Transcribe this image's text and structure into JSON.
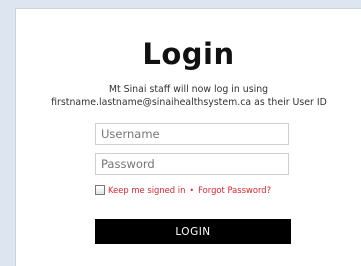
{
  "login": {
    "title": "Login",
    "instructions_line1": "Mt Sinai staff will now log in using",
    "instructions_line2": "firstname.lastname@sinaihealthsystem.ca as their User ID",
    "username_placeholder": "Username",
    "password_placeholder": "Password",
    "remember_label": "Keep me signed in",
    "separator": "•",
    "forgot_label": "Forgot Password?",
    "button_label": "LOGIN"
  },
  "colors": {
    "page_background": "#dde5f1",
    "link_red": "#d9262f",
    "button_black": "#000000"
  }
}
